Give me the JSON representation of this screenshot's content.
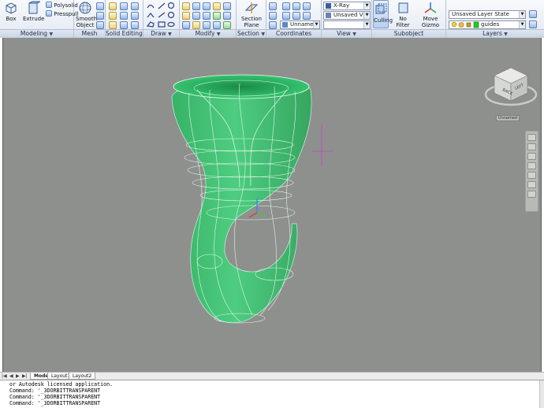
{
  "ribbon": {
    "panels": {
      "modeling": "Modeling",
      "mesh": "Mesh",
      "solid_editing": "Solid Editing",
      "draw": "Draw",
      "modify": "Modify",
      "section": "Section",
      "coordinates": "Coordinates",
      "view": "View",
      "subobject": "Subobject",
      "layers": "Layers"
    },
    "buttons": {
      "box": "Box",
      "extrude": "Extrude",
      "polysolid": "Polysolid",
      "presspull": "Presspull",
      "smooth_object_1": "Smooth",
      "smooth_object_2": "Object",
      "section_plane_1": "Section",
      "section_plane_2": "Plane",
      "culling": "Culling",
      "no_filter": "No Filter",
      "move_gizmo": "Move Gizmo"
    },
    "combos": {
      "visual_style": "X-Ray",
      "view": "Unsaved View",
      "ucs": "Unnamed",
      "layer_state": "Unsaved Layer State",
      "current_layer": "guides"
    },
    "colors": {
      "ribbon_accent": "#3f6fb0",
      "layer_color": "#22c822",
      "model_green": "#3fd17a"
    }
  },
  "viewport": {
    "viewcube": {
      "face_left": "BACK",
      "face_right": "LEFT"
    },
    "ucs_label": "Unnamed",
    "background": "#8e908d"
  },
  "tabs": {
    "items": [
      "Model",
      "Layout1",
      "Layout2"
    ],
    "active": "Model"
  },
  "command_line": {
    "lines": [
      "or Autodesk licensed application.",
      "Command: '_3DORBITTRANSPARENT",
      "Command: '_3DORBITTRANSPARENT",
      "Command: '_3DORBITTRANSPARENT"
    ]
  }
}
